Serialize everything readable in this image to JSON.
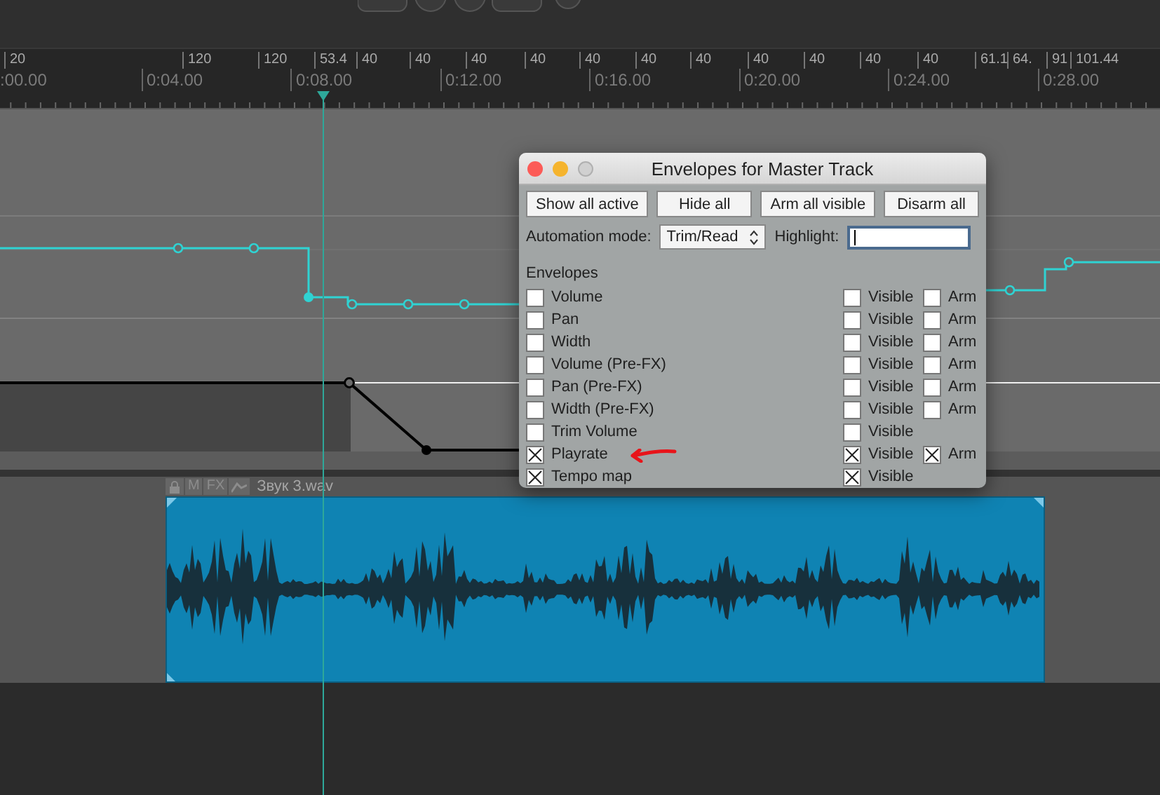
{
  "ruler": {
    "tempo_markers": [
      "20",
      "120",
      "120",
      "53.4",
      "40",
      "40",
      "40",
      "40",
      "40",
      "40",
      "40",
      "40",
      "40",
      "40",
      "40",
      "61.1",
      "64.",
      "91",
      "101.44"
    ],
    "time_labels": [
      ":00.00",
      "0:04.00",
      "0:08.00",
      "0:12.00",
      "0:16.00",
      "0:20.00",
      "0:24.00",
      "0:28.00"
    ]
  },
  "item": {
    "header_buttons": [
      "M",
      "FX"
    ],
    "name": "Звук 3.wav"
  },
  "dialog": {
    "title": "Envelopes for Master Track",
    "buttons": [
      "Show all active",
      "Hide all",
      "Arm all visible",
      "Disarm all"
    ],
    "automation_mode": {
      "label": "Automation mode:",
      "value": "Trim/Read"
    },
    "highlight": {
      "label": "Highlight:"
    },
    "envelopes_heading": "Envelopes",
    "envelopes": [
      {
        "name": "Volume",
        "checked": false,
        "visible": false,
        "arm": false,
        "visible_label": "Visible",
        "arm_label": "Arm",
        "annotated": false
      },
      {
        "name": "Pan",
        "checked": false,
        "visible": false,
        "arm": false,
        "visible_label": "Visible",
        "arm_label": "Arm",
        "annotated": false
      },
      {
        "name": "Width",
        "checked": false,
        "visible": false,
        "arm": false,
        "visible_label": "Visible",
        "arm_label": "Arm",
        "annotated": false
      },
      {
        "name": "Volume (Pre-FX)",
        "checked": false,
        "visible": false,
        "arm": false,
        "visible_label": "Visible",
        "arm_label": "Arm",
        "annotated": false
      },
      {
        "name": "Pan (Pre-FX)",
        "checked": false,
        "visible": false,
        "arm": false,
        "visible_label": "Visible",
        "arm_label": "Arm",
        "annotated": false
      },
      {
        "name": "Width (Pre-FX)",
        "checked": false,
        "visible": false,
        "arm": false,
        "visible_label": "Visible",
        "arm_label": "Arm",
        "annotated": false
      },
      {
        "name": "Trim Volume",
        "checked": false,
        "visible": false,
        "visible_label": "Visible",
        "annotated": false
      },
      {
        "name": "Playrate",
        "checked": true,
        "visible": true,
        "arm": true,
        "visible_label": "Visible",
        "arm_label": "Arm",
        "annotated": true
      },
      {
        "name": "Tempo map",
        "checked": true,
        "visible": true,
        "visible_label": "Visible",
        "annotated": false
      }
    ]
  }
}
